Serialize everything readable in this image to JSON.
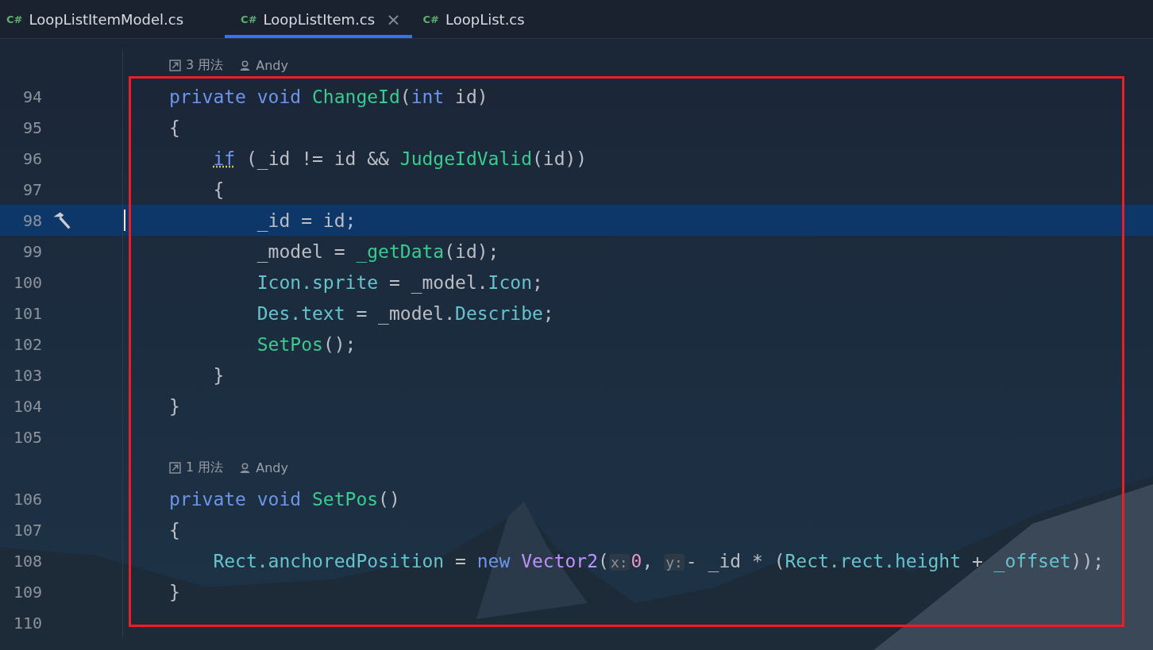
{
  "tabs": [
    {
      "lang": "C#",
      "label": "LoopListItemModel.cs",
      "selected": false
    },
    {
      "lang": "C#",
      "label": "LoopListItem.cs",
      "selected": true,
      "close": "×"
    },
    {
      "lang": "C#",
      "label": "LoopList.cs",
      "selected": false
    }
  ],
  "lines": [
    {
      "kind": "lens",
      "usages": "3 用法",
      "author": "Andy"
    },
    {
      "kind": "code",
      "number": "94",
      "current": false,
      "tokens": [
        {
          "kind": "kw",
          "s": "private void "
        },
        {
          "kind": "fn",
          "s": "ChangeId"
        },
        {
          "kind": "plain",
          "s": "("
        },
        {
          "kind": "kw",
          "s": "int"
        },
        {
          "kind": "plain",
          "s": " id)"
        }
      ]
    },
    {
      "kind": "code",
      "number": "95",
      "current": false,
      "tokens": [
        {
          "kind": "plain",
          "s": "{"
        }
      ]
    },
    {
      "kind": "code",
      "number": "96",
      "current": false,
      "tokens": [
        {
          "kind": "warn",
          "s": "    if"
        },
        {
          "kind": "plain",
          "s": " (_id != id && "
        },
        {
          "kind": "fn",
          "s": "JudgeIdValid"
        },
        {
          "kind": "plain",
          "s": "(id))"
        }
      ]
    },
    {
      "kind": "code",
      "number": "97",
      "current": false,
      "tokens": [
        {
          "kind": "plain",
          "s": "    {"
        }
      ]
    },
    {
      "kind": "code",
      "number": "98",
      "current": true,
      "tokens": [
        {
          "kind": "plain",
          "s": "        _id = id;"
        }
      ]
    },
    {
      "kind": "code",
      "number": "99",
      "current": false,
      "tokens": [
        {
          "kind": "plain",
          "s": "        _model = "
        },
        {
          "kind": "fn",
          "s": "_getData"
        },
        {
          "kind": "plain",
          "s": "(id);"
        }
      ]
    },
    {
      "kind": "code",
      "number": "100",
      "current": false,
      "tokens": [
        {
          "kind": "field",
          "s": "        Icon.sprite"
        },
        {
          "kind": "plain",
          "s": " = _model."
        },
        {
          "kind": "field",
          "s": "Icon"
        },
        {
          "kind": "plain",
          "s": ";"
        }
      ]
    },
    {
      "kind": "code",
      "number": "101",
      "current": false,
      "tokens": [
        {
          "kind": "field",
          "s": "        Des.text"
        },
        {
          "kind": "plain",
          "s": " = _model."
        },
        {
          "kind": "field",
          "s": "Describe"
        },
        {
          "kind": "plain",
          "s": ";"
        }
      ]
    },
    {
      "kind": "code",
      "number": "102",
      "current": false,
      "tokens": [
        {
          "kind": "fn",
          "s": "        SetPos"
        },
        {
          "kind": "plain",
          "s": "();"
        }
      ]
    },
    {
      "kind": "code",
      "number": "103",
      "current": false,
      "tokens": [
        {
          "kind": "plain",
          "s": "    }"
        }
      ]
    },
    {
      "kind": "code",
      "number": "104",
      "current": false,
      "tokens": [
        {
          "kind": "plain",
          "s": "}"
        }
      ]
    },
    {
      "kind": "code",
      "number": "105",
      "current": false
    },
    {
      "kind": "lens",
      "usages": "1 用法",
      "author": "Andy"
    },
    {
      "kind": "code",
      "number": "106",
      "current": false,
      "tokens": [
        {
          "kind": "kw",
          "s": "private void "
        },
        {
          "kind": "fn",
          "s": "SetPos"
        },
        {
          "kind": "plain",
          "s": "()"
        }
      ]
    },
    {
      "kind": "code",
      "number": "107",
      "current": false,
      "tokens": [
        {
          "kind": "plain",
          "s": "{"
        }
      ]
    },
    {
      "kind": "code",
      "number": "108",
      "current": false,
      "tokens": [
        {
          "kind": "field",
          "s": "    Rect.anchoredPosition"
        },
        {
          "kind": "plain",
          "s": " = "
        },
        {
          "kind": "kw",
          "s": "new "
        },
        {
          "kind": "type",
          "s": "Vector2"
        },
        {
          "kind": "plain",
          "s": "("
        },
        {
          "kind": "hint",
          "s": "x:"
        },
        {
          "kind": "num",
          "s": "0"
        },
        {
          "kind": "plain",
          "s": ", "
        },
        {
          "kind": "hint",
          "s": "y:"
        },
        {
          "kind": "plain",
          "s": "- _id * ("
        },
        {
          "kind": "field",
          "s": "Rect.rect.height"
        },
        {
          "kind": "plain",
          "s": " + "
        },
        {
          "kind": "field",
          "s": "_offset"
        },
        {
          "kind": "plain",
          "s": "));"
        }
      ]
    },
    {
      "kind": "code",
      "number": "109",
      "current": false,
      "tokens": [
        {
          "kind": "plain",
          "s": "}"
        }
      ]
    },
    {
      "kind": "code",
      "number": "110",
      "current": false
    }
  ]
}
